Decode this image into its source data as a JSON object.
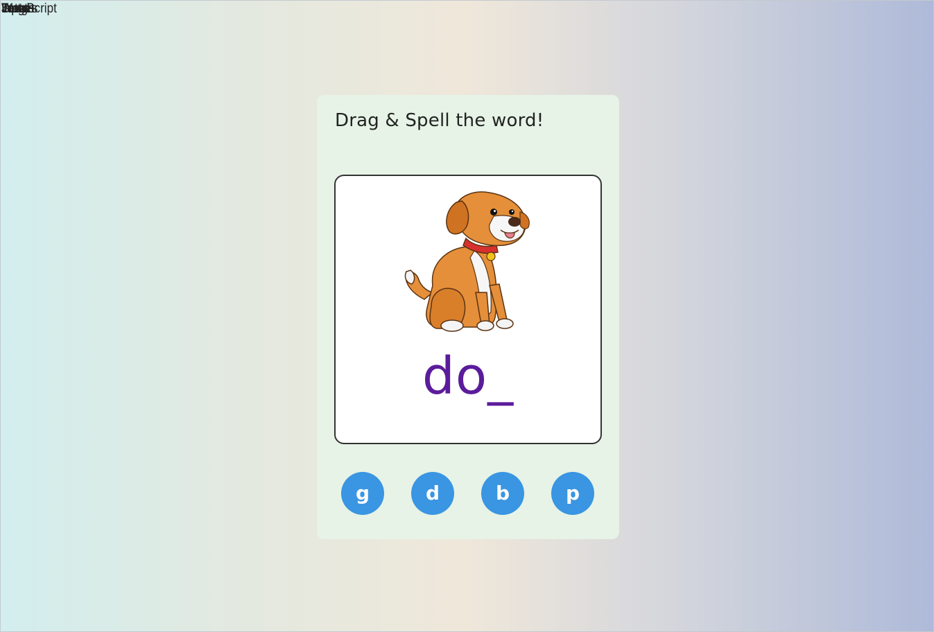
{
  "overlay_labels": [
    "JavaScript",
    "Letters",
    "Word",
    "Target",
    "Image",
    "Input",
    "Stats"
  ],
  "card": {
    "instruction": "Drag & Spell the word!",
    "picture_subject": "dog-icon",
    "partial_word": "do_",
    "letter_options": [
      "g",
      "d",
      "b",
      "p"
    ]
  },
  "colors": {
    "card_bg": "#e6f3e6",
    "word": "#5b1c9b",
    "letter_tile": "#3a95e2"
  }
}
